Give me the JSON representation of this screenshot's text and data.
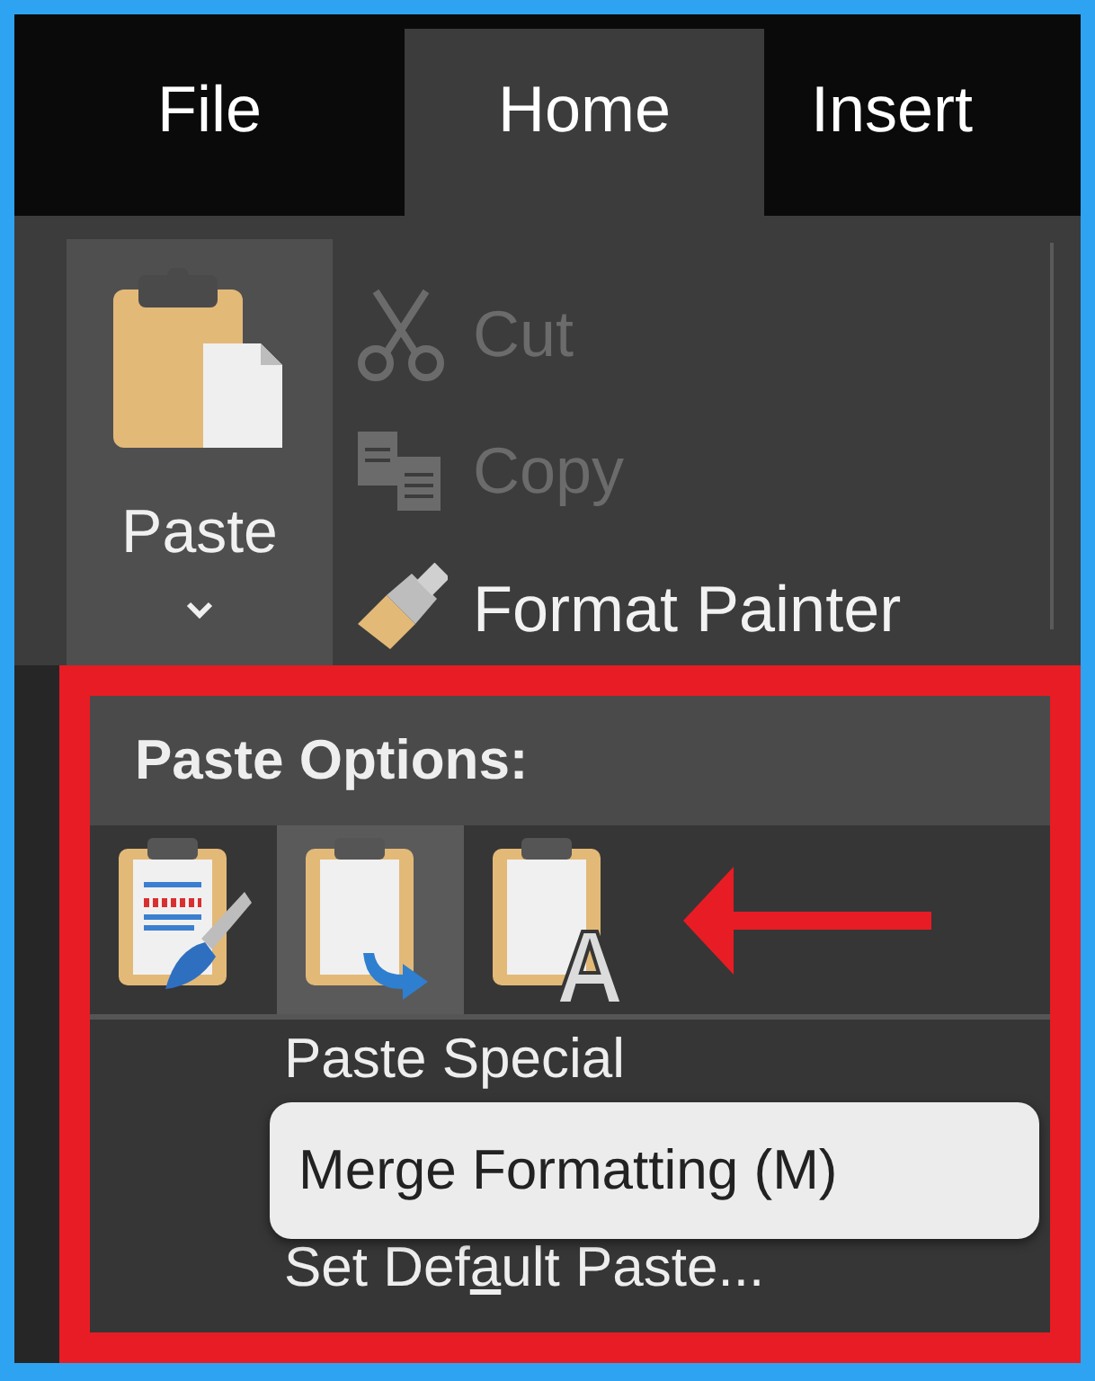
{
  "tabs": [
    {
      "label": "File",
      "selected": false
    },
    {
      "label": "Home",
      "selected": true
    },
    {
      "label": "Insert",
      "selected": false
    }
  ],
  "clipboard": {
    "paste_label": "Paste",
    "commands": [
      {
        "kind": "cut",
        "label": "Cut",
        "disabled": true
      },
      {
        "kind": "copy",
        "label": "Copy",
        "disabled": true
      },
      {
        "kind": "format_painter",
        "label": "Format Painter",
        "disabled": false
      }
    ]
  },
  "paste_menu": {
    "title": "Paste Options:",
    "options": [
      {
        "kind": "keep_source",
        "selected": false
      },
      {
        "kind": "merge",
        "selected": true
      },
      {
        "kind": "text_only",
        "selected": false
      }
    ],
    "items": [
      {
        "label_before": "Paste Special"
      },
      {
        "label_before": "Set Def",
        "access_key": "a",
        "label_after": "ult Paste..."
      }
    ],
    "tooltip": "Merge Formatting (M)"
  }
}
